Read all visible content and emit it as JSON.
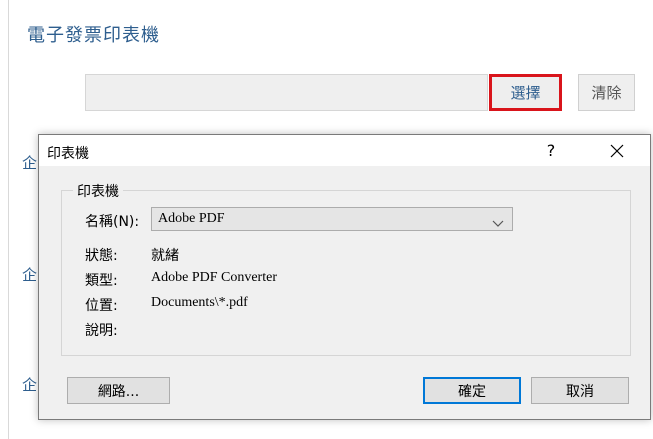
{
  "background_page": {
    "title": "電子發票印表機",
    "select_button": "選擇",
    "clear_button": "清除",
    "side_labels": [
      "企",
      "企",
      "企"
    ]
  },
  "dialog": {
    "title": "印表機",
    "help_label": "?",
    "close_icon": "close-icon",
    "group_label": "印表機",
    "name_label": "名稱(N):",
    "name_value": "Adobe PDF",
    "status_label": "狀態:",
    "status_value": "就緒",
    "type_label": "類型:",
    "type_value": "Adobe PDF Converter",
    "location_label": "位置:",
    "location_value": "Documents\\*.pdf",
    "comment_label": "說明:",
    "comment_value": "",
    "network_button": "網路...",
    "ok_button": "確定",
    "cancel_button": "取消"
  },
  "colors": {
    "highlight_border": "#d9141b",
    "link_blue": "#2e5e8e",
    "default_button_border": "#0078d7"
  }
}
